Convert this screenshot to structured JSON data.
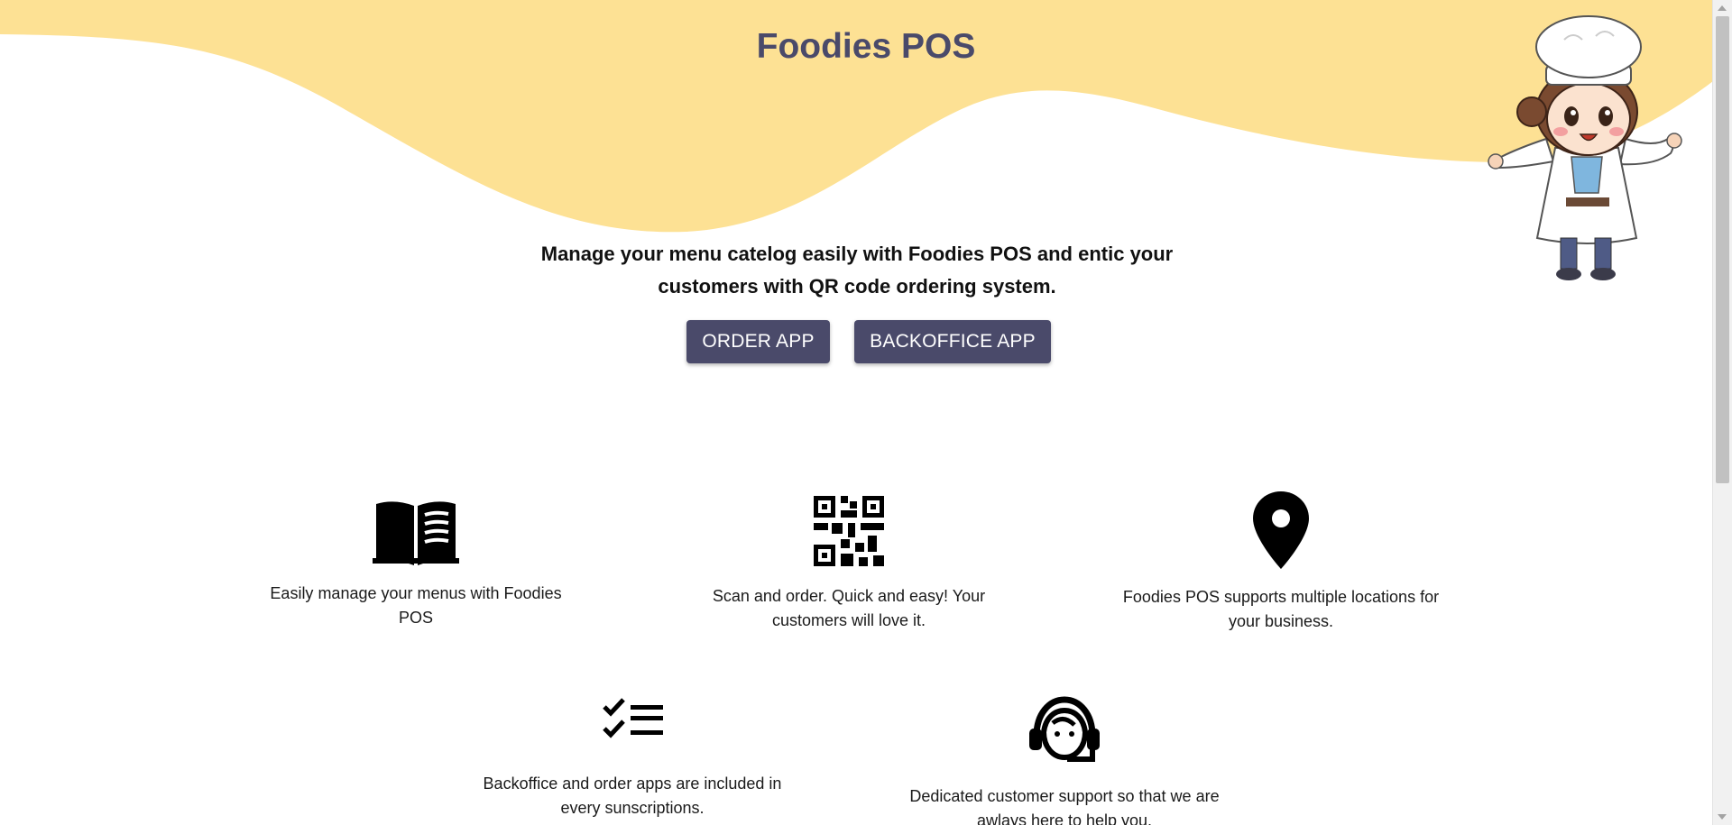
{
  "header": {
    "title": "Foodies POS",
    "wave_color": "#fde194",
    "illustration": "chef-mascot"
  },
  "hero": {
    "tagline": "Manage your menu catelog easily with Foodies POS and entic your customers with QR code ordering system.",
    "order_button": "ORDER APP",
    "backoffice_button": "BACKOFFICE APP",
    "button_color": "#4a4a6a"
  },
  "features": [
    {
      "icon": "menu-book-icon",
      "text": "Easily manage your menus with Foodies POS"
    },
    {
      "icon": "qr-code-icon",
      "text": "Scan and order. Quick and easy! Your customers will love it."
    },
    {
      "icon": "location-pin-icon",
      "text": "Foodies POS supports multiple locations for your business."
    },
    {
      "icon": "checklist-icon",
      "text": "Backoffice and order apps are included in every sunscriptions."
    },
    {
      "icon": "support-agent-icon",
      "text": "Dedicated customer support so that we are awlays here to help you."
    }
  ]
}
